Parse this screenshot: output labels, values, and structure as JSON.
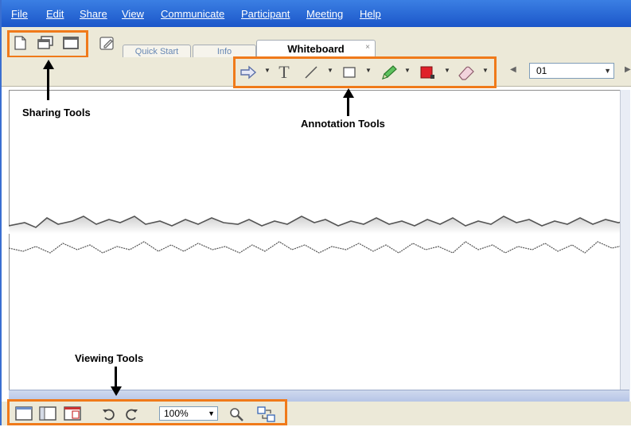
{
  "menu": {
    "items": [
      "File",
      "Edit",
      "Share",
      "View",
      "Communicate",
      "Participant",
      "Meeting",
      "Help"
    ]
  },
  "tabs": {
    "quick_start": "Quick Start",
    "info": "Info",
    "whiteboard": "Whiteboard",
    "close_glyph": "×"
  },
  "toolbar": {
    "page_value": "01"
  },
  "bottom_toolbar": {
    "zoom_value": "100%"
  },
  "callouts": {
    "sharing_label": "Sharing Tools",
    "annotation_label": "Annotation Tools",
    "viewing_label": "Viewing Tools"
  },
  "colors": {
    "menu_bar": "#1b56c9",
    "callout_border": "#f07a1a",
    "annotation_color": "#e0202a",
    "pencil": "#3aa63a"
  },
  "icons": {
    "sharing": [
      "share-document-icon",
      "share-application-icon",
      "share-desktop-icon"
    ],
    "annotation": [
      "pointer-icon",
      "text-icon",
      "line-icon",
      "rectangle-icon",
      "pencil-icon",
      "color-icon",
      "eraser-icon"
    ],
    "viewing": [
      "full-screen-icon",
      "thumbnails-icon",
      "display-icon",
      "rotate-left-icon",
      "rotate-right-icon",
      "zoom-icon",
      "sync-display-icon"
    ]
  }
}
